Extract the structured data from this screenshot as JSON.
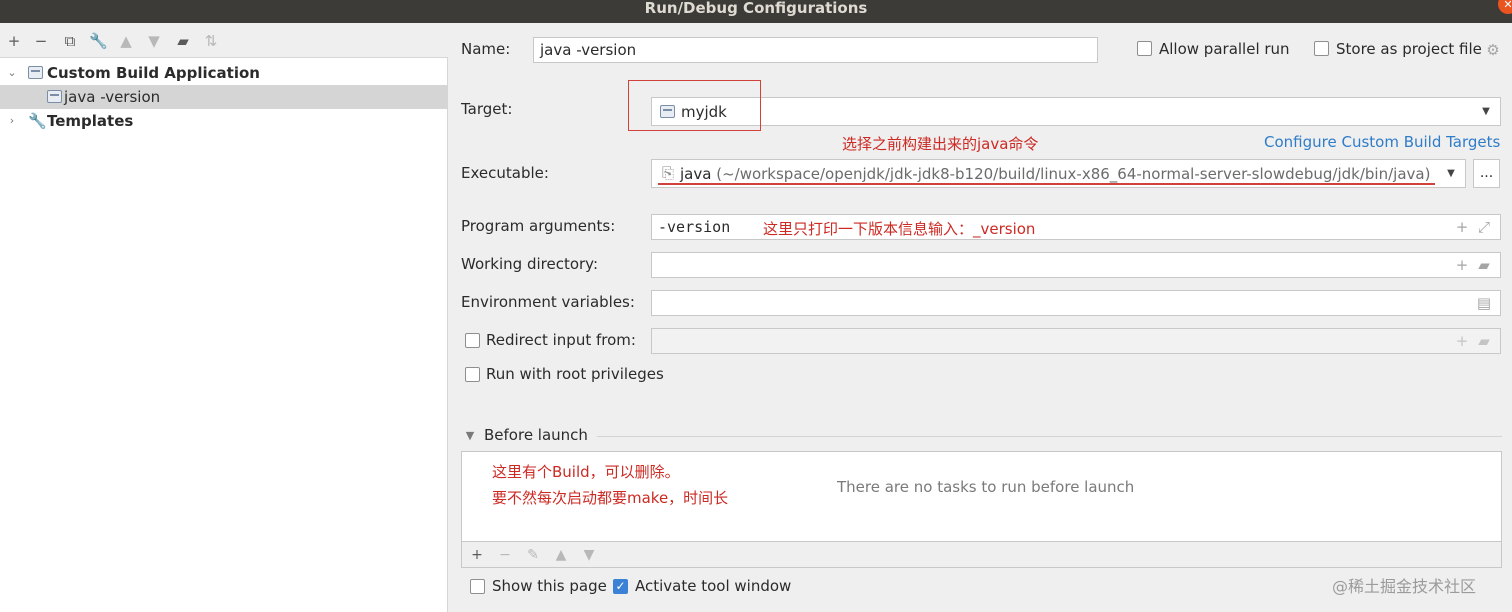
{
  "window": {
    "title": "Run/Debug Configurations"
  },
  "toolbar": {
    "icons": [
      "plus-icon",
      "minus-icon",
      "copy-icon",
      "wrench-icon",
      "arrow-up-icon",
      "arrow-down-icon",
      "folder-icon",
      "sort-icon"
    ]
  },
  "tree": {
    "group_label": "Custom Build Application",
    "child_label": "java -version",
    "templates_label": "Templates"
  },
  "form": {
    "name_label": "Name:",
    "name_value": "java -version",
    "allow_parallel_label": "Allow parallel run",
    "store_project_label": "Store as project file",
    "target_label": "Target:",
    "target_value": "myjdk",
    "configure_targets_link": "Configure Custom Build Targets",
    "executable_label": "Executable:",
    "executable_name": "java",
    "executable_path": "(~/workspace/openjdk/jdk-jdk8-b120/build/linux-x86_64-normal-server-slowdebug/jdk/bin/java)",
    "browse_label": "...",
    "program_args_label": "Program arguments:",
    "program_args_value": "-version",
    "working_dir_label": "Working directory:",
    "env_vars_label": "Environment variables:",
    "redirect_label": "Redirect input from:",
    "root_privileges_label": "Run with root privileges"
  },
  "before_launch": {
    "title": "Before launch",
    "empty_text": "There are no tasks to run before launch"
  },
  "bottom": {
    "show_page_label": "Show this page",
    "activate_tool_window_label": "Activate tool window"
  },
  "annotations": {
    "target_note": "选择之前构建出来的java命令",
    "args_note": "这里只打印一下版本信息输入：_version",
    "before_launch_note_1": "这里有个Build，可以删除。",
    "before_launch_note_2": "要不然每次启动都要make，时间长"
  },
  "watermark": "@稀土掘金技术社区",
  "colors": {
    "annotation_red": "#cc2a23",
    "link_blue": "#2f7cc8",
    "checkbox_blue": "#3b82d6",
    "titlebar": "#3c3b37"
  }
}
